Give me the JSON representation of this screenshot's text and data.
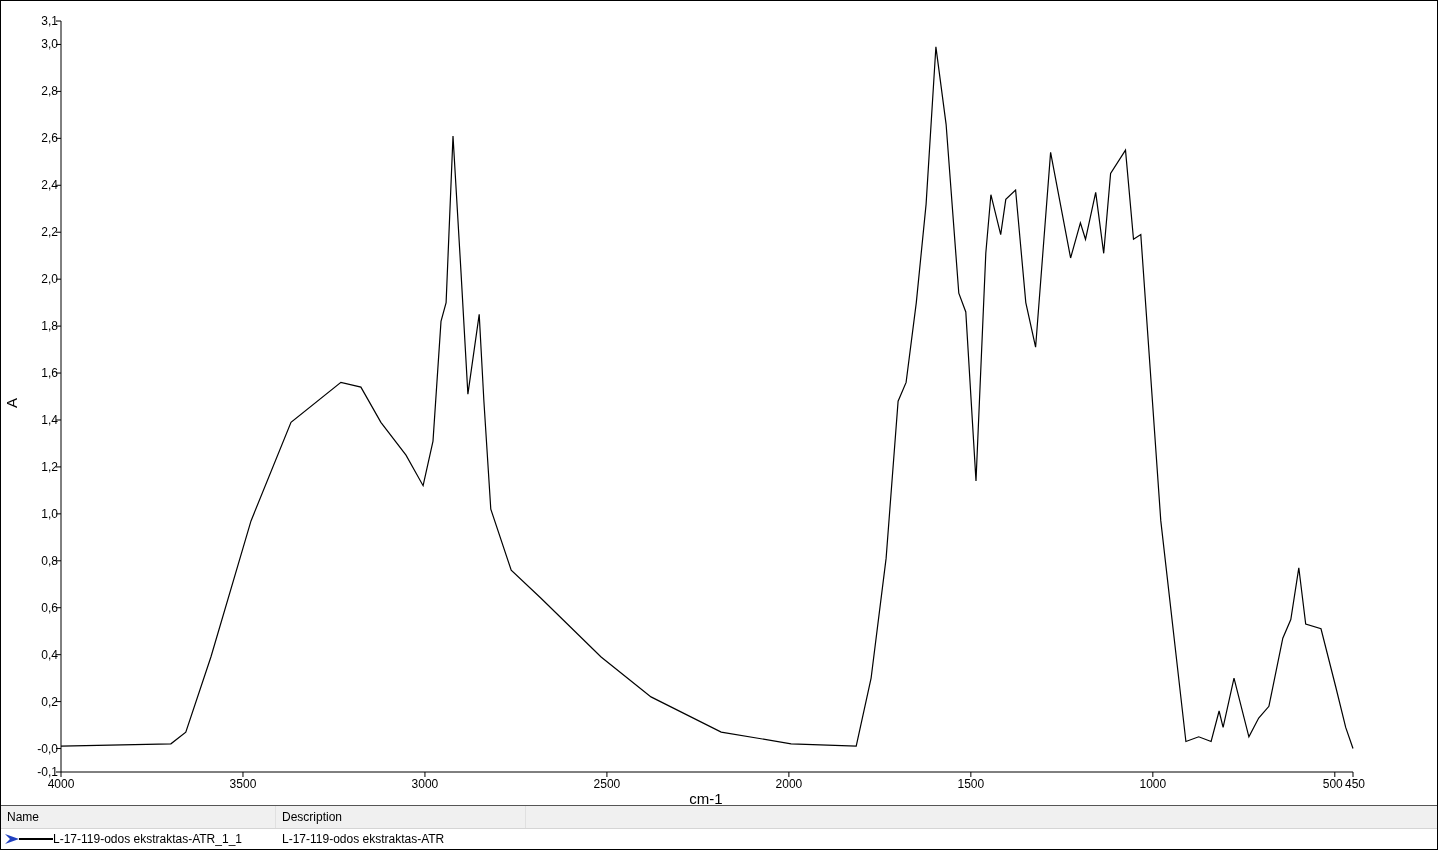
{
  "chart": {
    "chart_data": {
      "type": "line",
      "xlabel": "cm-1",
      "ylabel": "A",
      "xlim": [
        4000,
        450
      ],
      "ylim": [
        -0.1,
        3.1
      ],
      "xticks": [
        4000,
        3500,
        3000,
        2500,
        2000,
        1500,
        1000,
        500,
        450
      ],
      "yticks": [
        {
          "value": -0.1,
          "label": "-0,1"
        },
        {
          "value": 0,
          "label": "-0,0"
        },
        {
          "value": 0.2,
          "label": "0,2"
        },
        {
          "value": 0.4,
          "label": "0,4"
        },
        {
          "value": 0.6,
          "label": "0,6"
        },
        {
          "value": 0.8,
          "label": "0,8"
        },
        {
          "value": 1.0,
          "label": "1,0"
        },
        {
          "value": 1.2,
          "label": "1,2"
        },
        {
          "value": 1.4,
          "label": "1,4"
        },
        {
          "value": 1.6,
          "label": "1,6"
        },
        {
          "value": 1.8,
          "label": "1,8"
        },
        {
          "value": 2.0,
          "label": "2,0"
        },
        {
          "value": 2.2,
          "label": "2,2"
        },
        {
          "value": 2.4,
          "label": "2,4"
        },
        {
          "value": 2.6,
          "label": "2,6"
        },
        {
          "value": 2.8,
          "label": "2,8"
        },
        {
          "value": 3.0,
          "label": "3,0"
        },
        {
          "value": 3.1,
          "label": "3,1"
        }
      ],
      "x": [
        4000,
        3698,
        3657,
        3588,
        3478,
        3368,
        3231,
        3176,
        3121,
        3052,
        3005,
        2978,
        2956,
        2942,
        2923,
        2901,
        2882,
        2851,
        2838,
        2819,
        2763,
        2681,
        2516,
        2379,
        2186,
        1994,
        1815,
        1774,
        1733,
        1700,
        1678,
        1650,
        1623,
        1596,
        1568,
        1533,
        1514,
        1486,
        1459,
        1445,
        1418,
        1404,
        1377,
        1349,
        1322,
        1281,
        1226,
        1199,
        1185,
        1157,
        1135,
        1116,
        1075,
        1053,
        1033,
        978,
        909,
        874,
        840,
        818,
        807,
        777,
        736,
        709,
        681,
        643,
        621,
        599,
        580,
        538,
        497,
        470,
        450
      ],
      "series": [
        {
          "name": "L-17-119-odos ekstraktas-ATR_1_1",
          "color": "#000000",
          "values": [
            0.01,
            0.02,
            0.07,
            0.39,
            0.97,
            1.39,
            1.56,
            1.54,
            1.39,
            1.25,
            1.12,
            1.31,
            1.82,
            1.9,
            2.61,
            2.03,
            1.51,
            1.85,
            1.48,
            1.02,
            0.76,
            0.64,
            0.39,
            0.22,
            0.07,
            0.02,
            0.01,
            0.3,
            0.81,
            1.48,
            1.56,
            1.9,
            2.32,
            2.99,
            2.66,
            1.94,
            1.86,
            1.14,
            2.11,
            2.36,
            2.19,
            2.34,
            2.38,
            1.9,
            1.71,
            2.54,
            2.09,
            2.24,
            2.17,
            2.37,
            2.11,
            2.45,
            2.55,
            2.17,
            2.19,
            0.97,
            0.03,
            0.05,
            0.03,
            0.16,
            0.09,
            0.3,
            0.05,
            0.13,
            0.18,
            0.47,
            0.55,
            0.77,
            0.53,
            0.51,
            0.26,
            0.09,
            0.0
          ]
        }
      ]
    }
  },
  "table": {
    "columns": [
      "Name",
      "Description"
    ],
    "rows": [
      {
        "current": true,
        "description": "L-17-119-odos ekstraktas-ATR"
      }
    ]
  }
}
